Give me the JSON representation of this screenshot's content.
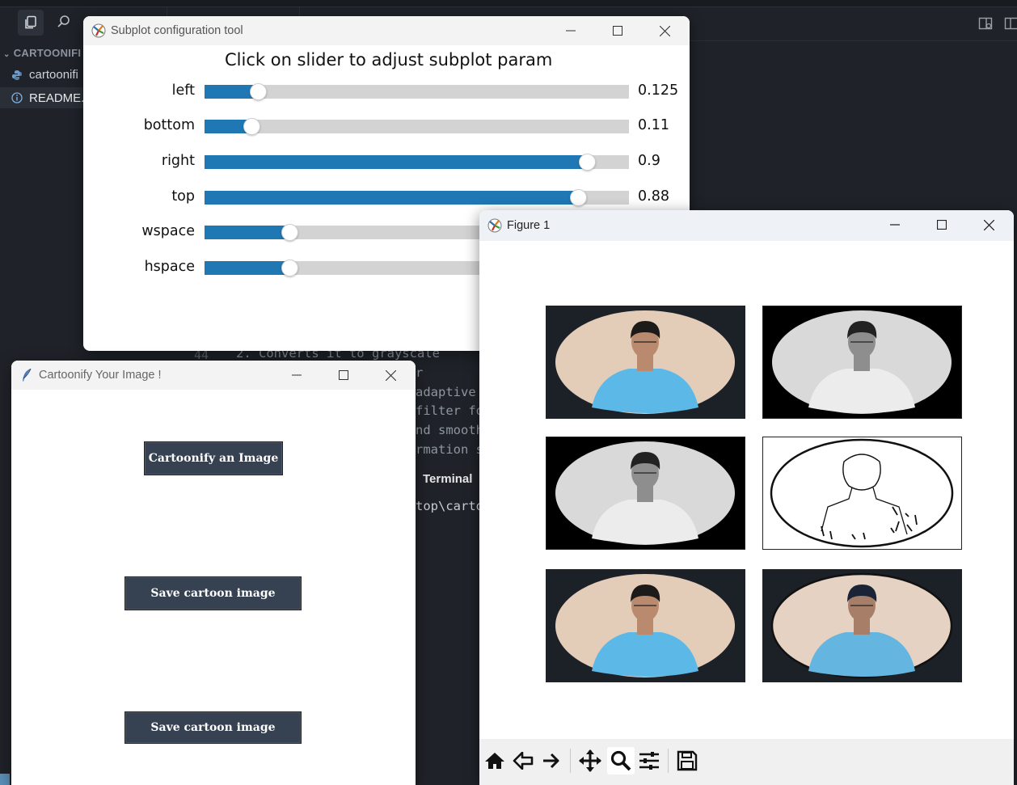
{
  "vscode": {
    "explorer_title": "CARTOONIFI",
    "files": [
      {
        "name": "cartoonifi",
        "icon": "python-icon"
      },
      {
        "name": "README.",
        "icon": "info-icon"
      }
    ],
    "code": {
      "line_number": "44",
      "lines": [
        "2. Converts it to grayscale",
        "r",
        "adaptive",
        "filter fo",
        "nd smooth",
        "rmation s"
      ]
    },
    "terminal_tab": "Terminal",
    "terminal_line": "top\\carto"
  },
  "subplot_tool": {
    "title": "Subplot configuration tool",
    "heading": "Click on slider to adjust subplot param",
    "sliders": [
      {
        "label": "left",
        "value": 0.125,
        "display": "0.125"
      },
      {
        "label": "bottom",
        "value": 0.11,
        "display": "0.11"
      },
      {
        "label": "right",
        "value": 0.9,
        "display": "0.9"
      },
      {
        "label": "top",
        "value": 0.88,
        "display": "0.88"
      },
      {
        "label": "wspace",
        "value": 0.2,
        "display": ""
      },
      {
        "label": "hspace",
        "value": 0.2,
        "display": ""
      }
    ],
    "slider_color": "#1f77b4"
  },
  "figure": {
    "title": "Figure 1",
    "panels": [
      {
        "kind": "color"
      },
      {
        "kind": "grayscale"
      },
      {
        "kind": "grayscale"
      },
      {
        "kind": "edges"
      },
      {
        "kind": "color"
      },
      {
        "kind": "cartoon"
      }
    ],
    "toolbar": [
      "home-icon",
      "back-icon",
      "forward-icon",
      "pan-icon",
      "zoom-icon",
      "configure-subplots-icon",
      "save-icon"
    ]
  },
  "cartoonify": {
    "title": "Cartoonify Your Image !",
    "buttons": {
      "cartoonify": "Cartoonify an Image",
      "save1": "Save cartoon image",
      "save2": "Save cartoon image"
    },
    "button_color": "#364152"
  }
}
